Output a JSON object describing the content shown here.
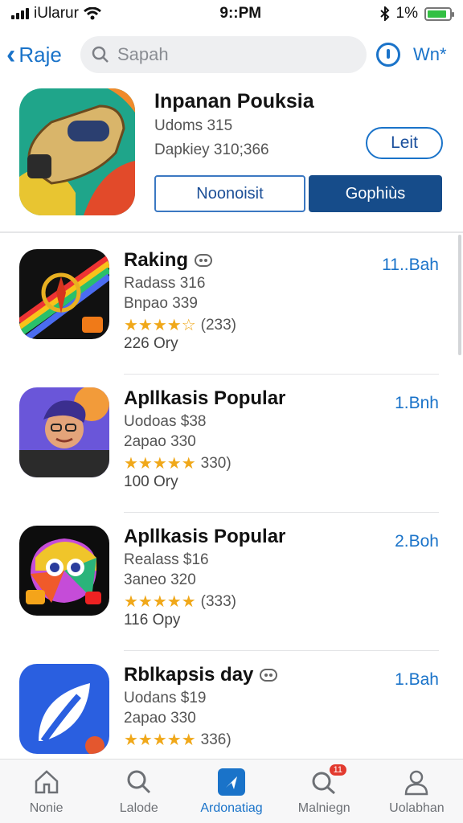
{
  "status_bar": {
    "carrier": "iUlarur",
    "time": "9::PM",
    "battery_percent": "1%",
    "battery_level": 0.9
  },
  "nav": {
    "back_label": "Raje",
    "search_placeholder": "Sapah",
    "right_label": "Wn*"
  },
  "featured": {
    "title": "Inpanan Pouksia",
    "subtitle1": "Udoms 315",
    "subtitle2": "Dapkiey 310;366",
    "get_label": "Leit",
    "button_outline": "Noonoisit",
    "button_solid": "Gophiùs"
  },
  "apps": [
    {
      "name": "Raking",
      "has_game_icon": true,
      "line1": "Radass 316",
      "line2": "Bnpao 339",
      "stars": "★★★★☆",
      "rating_count": "(233)",
      "size": "226 Ory",
      "price": "11..Bah",
      "icon": "compass-rainbow-icon"
    },
    {
      "name": "Apllkasis Popular",
      "has_game_icon": false,
      "line1": "Uodoas $38",
      "line2": "2apao 330",
      "stars": "★★★★★",
      "rating_count": "330)",
      "size": "100 Ory",
      "price": "1.Bnh",
      "icon": "avatar-character-icon"
    },
    {
      "name": "Apllkasis Popular",
      "has_game_icon": false,
      "line1": "Realass $16",
      "line2": "3aneo 320",
      "stars": "★★★★★",
      "rating_count": "(333)",
      "size": "116 Opy",
      "price": "2.Boh",
      "icon": "colorful-monster-icon"
    },
    {
      "name": "Rblkapsis day",
      "has_game_icon": true,
      "line1": "Uodans $19",
      "line2": "2apao 330",
      "stars": "★★★★★",
      "rating_count": "336)",
      "size": "",
      "price": "1.Bah",
      "icon": "blue-leaf-icon"
    }
  ],
  "tabs": [
    {
      "label": "Nonie",
      "icon": "home-icon",
      "active": false
    },
    {
      "label": "Lalode",
      "icon": "search-icon",
      "active": false
    },
    {
      "label": "Ardonatiag",
      "icon": "arrow-icon",
      "active": true
    },
    {
      "label": "Malniegn",
      "icon": "search-badge-icon",
      "active": false,
      "badge": "11"
    },
    {
      "label": "Uolabhan",
      "icon": "profile-icon",
      "active": false
    }
  ],
  "colors": {
    "accent": "#1a73c9",
    "solid_button": "#164c8a",
    "star": "#f0a81a",
    "battery": "#33c043"
  }
}
